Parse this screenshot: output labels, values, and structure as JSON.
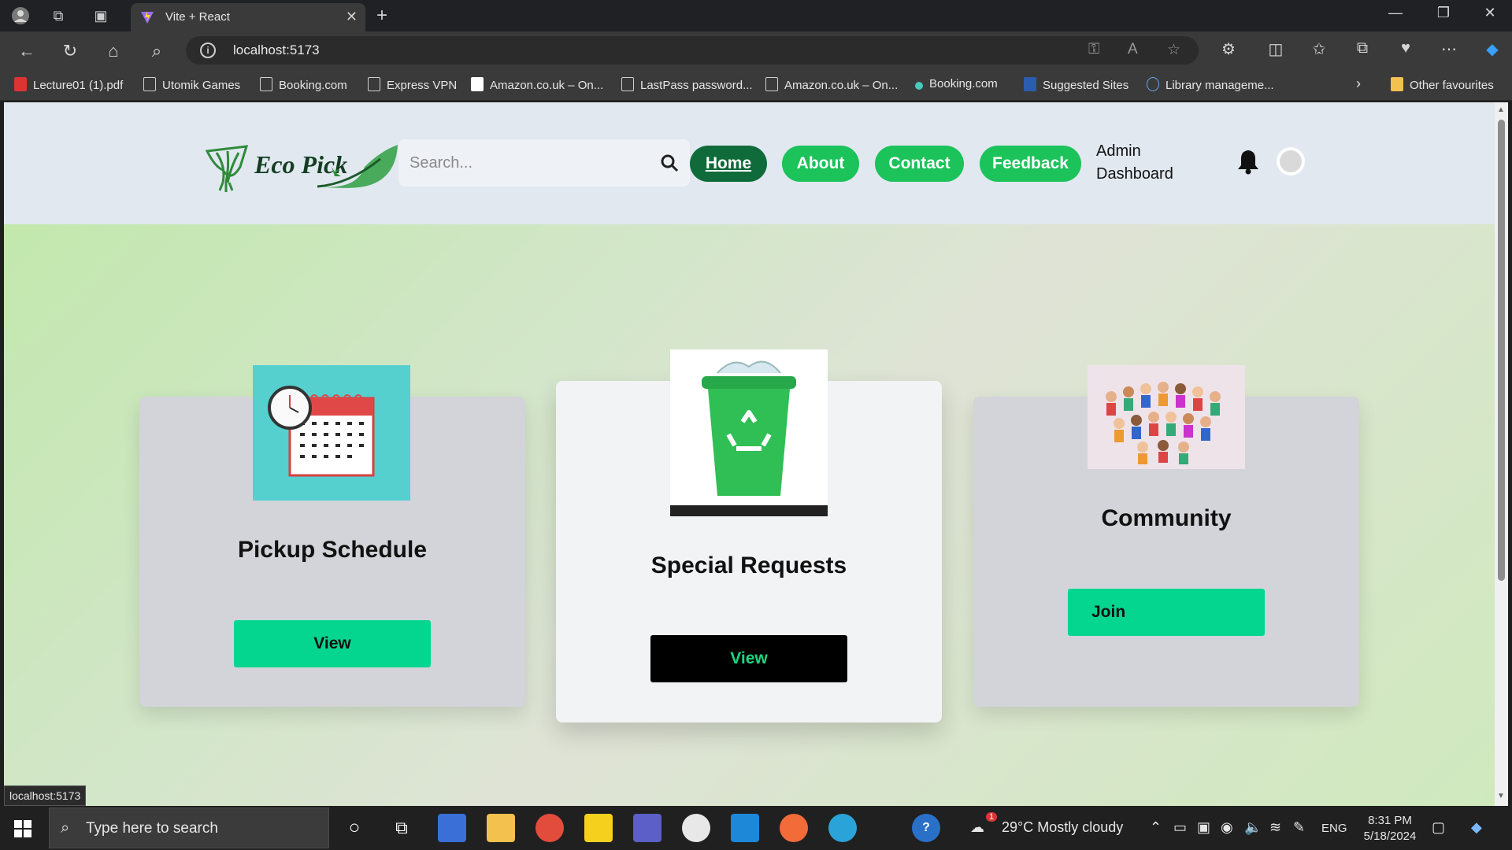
{
  "browser": {
    "tab_title": "Vite + React",
    "url": "localhost:5173",
    "bookmarks": [
      "Lecture01 (1).pdf",
      "Utomik Games",
      "Booking.com",
      "Express VPN",
      "Amazon.co.uk – On...",
      "LastPass password...",
      "Amazon.co.uk – On...",
      "Booking.com",
      "Suggested Sites",
      "Library manageme..."
    ],
    "other_favourites": "Other favourites",
    "status_url": "localhost:5173"
  },
  "header": {
    "logo_text": "Eco Pick",
    "search_placeholder": "Search...",
    "nav": [
      "Home",
      "About",
      "Contact",
      "Feedback"
    ],
    "admin_line1": "Admin",
    "admin_line2": "Dashboard"
  },
  "cards": [
    {
      "title": "Pickup Schedule",
      "button": "View"
    },
    {
      "title": "Special Requests",
      "button": "View"
    },
    {
      "title": "Community",
      "button": "Join"
    }
  ],
  "taskbar": {
    "search_placeholder": "Type here to search",
    "weather": "29°C  Mostly cloudy",
    "lang": "ENG",
    "time": "8:31 PM",
    "date": "5/18/2024",
    "weather_badge": "1"
  },
  "colors": {
    "nav_green": "#1cc25a",
    "nav_active": "#106b3a",
    "button_teal": "#05d68f",
    "button_dark": "#000000"
  }
}
